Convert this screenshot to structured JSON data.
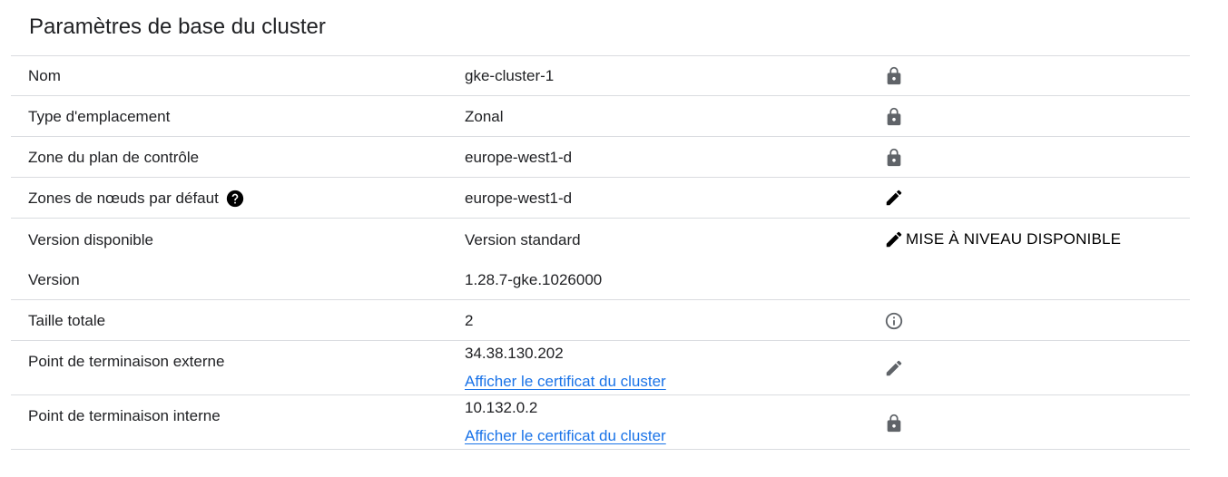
{
  "section": {
    "title": "Paramètres de base du cluster"
  },
  "rows": [
    {
      "label": "Nom",
      "value": "gke-cluster-1",
      "action_icon": "lock-icon"
    },
    {
      "label": "Type d'emplacement",
      "value": "Zonal",
      "action_icon": "lock-icon"
    },
    {
      "label": "Zone du plan de contrôle",
      "value": "europe-west1-d",
      "action_icon": "lock-icon"
    },
    {
      "label": "Zones de nœuds par défaut",
      "value": "europe-west1-d",
      "action_icon": "edit-icon",
      "help_icon": "help-icon"
    },
    {
      "label": "Version disponible",
      "value": "Version standard",
      "action_icon": "edit-icon",
      "action_label": "MISE À NIVEAU DISPONIBLE"
    },
    {
      "label": "Version",
      "value": "1.28.7-gke.1026000"
    },
    {
      "label": "Taille totale",
      "value": "2",
      "action_icon": "info-icon"
    },
    {
      "label": "Point de terminaison externe",
      "value": "34.38.130.202",
      "link": "Afficher le certificat du cluster",
      "action_icon": "edit-icon"
    },
    {
      "label": "Point de terminaison interne",
      "value": "10.132.0.2",
      "link": "Afficher le certificat du cluster",
      "action_icon": "lock-icon"
    }
  ],
  "colors": {
    "text": "#202124",
    "border": "#dadce0",
    "link": "#1a73e8",
    "icon_muted": "#5f6368",
    "icon_dark": "#000000"
  }
}
